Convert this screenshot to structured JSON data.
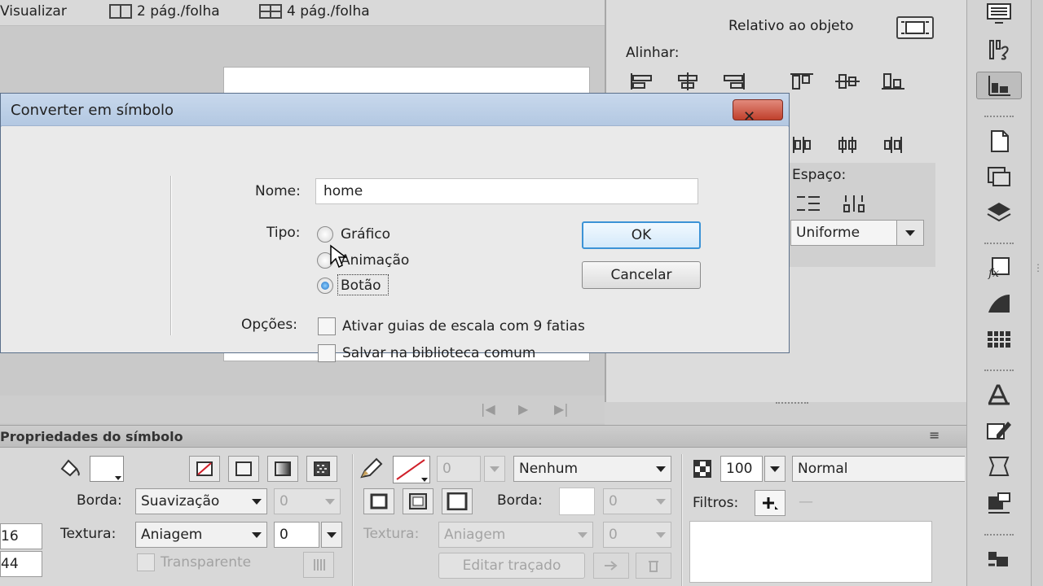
{
  "toolbar": {
    "visualize_label": "Visualizar",
    "two_pages_label": "2 pág./folha",
    "four_pages_label": "4 pág./folha"
  },
  "align_panel": {
    "relative_label": "Relativo ao objeto",
    "align_label": "Alinhar:",
    "space_label": "Espaço:",
    "space_select": "Uniforme"
  },
  "dialog": {
    "title": "Converter em símbolo",
    "close_label": "✕",
    "name_label": "Nome:",
    "name_value": "home",
    "type_label": "Tipo:",
    "types": [
      {
        "label": "Gráfico",
        "selected": false
      },
      {
        "label": "Animação",
        "selected": false
      },
      {
        "label": "Botão",
        "selected": true
      }
    ],
    "options_label": "Opções:",
    "options": [
      {
        "label": "Ativar guias de escala com 9 fatias",
        "checked": false
      },
      {
        "label": "Salvar na biblioteca comum",
        "checked": false
      }
    ],
    "ok_label": "OK",
    "cancel_label": "Cancelar"
  },
  "properties": {
    "title": "Propriedades do símbolo",
    "left_value_1": "16",
    "left_value_2": "44",
    "fill": {
      "border_label": "Borda:",
      "border_select": "Suavização",
      "border_value": "0",
      "texture_label": "Textura:",
      "texture_select": "Aniagem",
      "texture_value": "0",
      "transparent_label": "Transparente"
    },
    "stroke": {
      "width_value": "0",
      "style_select": "Nenhum",
      "border_label": "Borda:",
      "border_value": "0",
      "texture_label": "Textura:",
      "texture_select": "Aniagem",
      "texture_value": "0",
      "edit_stroke_label": "Editar traçado"
    },
    "effects": {
      "alpha_value": "100",
      "blend_select": "Normal",
      "filters_label": "Filtros:"
    }
  },
  "colors": {
    "dialog_title_bg": "#b9cde6",
    "close_button": "#c9503c",
    "ok_border": "#3c93d6",
    "panel_bg": "#d8d8d8"
  }
}
